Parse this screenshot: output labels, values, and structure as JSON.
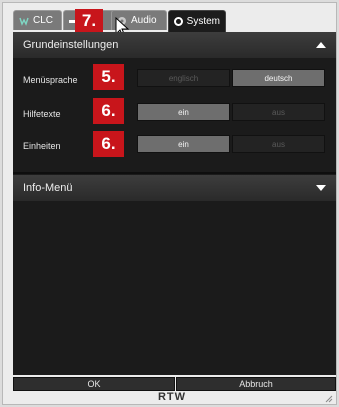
{
  "tabs": [
    {
      "label": "CLC",
      "icon": "chart-icon"
    },
    {
      "label": "",
      "icon": "bar-icon"
    },
    {
      "label": "Audio",
      "icon": "speaker-icon"
    },
    {
      "label": "System",
      "icon": "gear-icon",
      "active": true
    }
  ],
  "markers": {
    "tabs": "7.",
    "language": "5.",
    "help": "6.",
    "units": "6."
  },
  "sections": {
    "basic": {
      "title": "Grundeinstellungen",
      "expanded": true
    },
    "info": {
      "title": "Info-Menü",
      "expanded": false
    }
  },
  "settings": {
    "language": {
      "label": "Menüsprache",
      "options": [
        "englisch",
        "deutsch"
      ],
      "selected": "deutsch"
    },
    "help": {
      "label": "Hilfetexte",
      "options": [
        "ein",
        "aus"
      ],
      "selected": "ein"
    },
    "units": {
      "label": "Einheiten",
      "options": [
        "ein",
        "aus"
      ],
      "selected": "ein"
    }
  },
  "footer": {
    "ok": "OK",
    "cancel": "Abbruch"
  },
  "logo": "RTW",
  "colors": {
    "marker": "#c8151b",
    "panel": "#1b1b1b",
    "selected": "#6e6e6e"
  }
}
